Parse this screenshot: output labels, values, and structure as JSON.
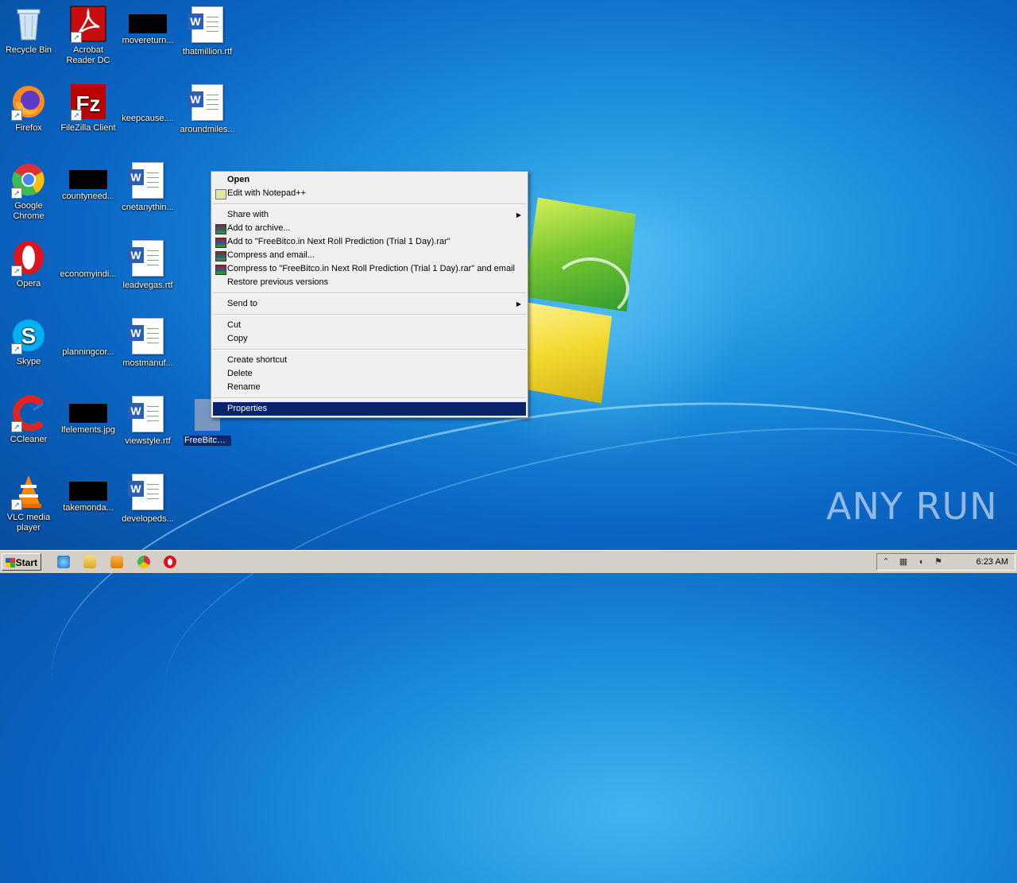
{
  "desktop": {
    "icons": [
      {
        "name": "Recycle Bin"
      },
      {
        "name": "Acrobat Reader DC"
      },
      {
        "name": "movereturn..."
      },
      {
        "name": "thatmillion.rtf"
      },
      {
        "name": "Firefox"
      },
      {
        "name": "FileZilla Client"
      },
      {
        "name": "keepcause...."
      },
      {
        "name": "aroundmiles..."
      },
      {
        "name": "Google Chrome"
      },
      {
        "name": "countyneed..."
      },
      {
        "name": "cnetanythin..."
      },
      {
        "name": "Opera"
      },
      {
        "name": "economyindi..."
      },
      {
        "name": "leadvegas.rtf"
      },
      {
        "name": "Skype"
      },
      {
        "name": "planningcor..."
      },
      {
        "name": "mostmanuf..."
      },
      {
        "name": "CCleaner"
      },
      {
        "name": "lfelements.jpg"
      },
      {
        "name": "viewstyle.rtf"
      },
      {
        "name": "VLC media player"
      },
      {
        "name": "takemonda..."
      },
      {
        "name": "developeds..."
      }
    ],
    "selected_file": {
      "name": "FreeBitco.in Next Roll Prediction (Trial 1 Day).bin"
    }
  },
  "context_menu": {
    "items": [
      {
        "label": "Open",
        "bold": true
      },
      {
        "label": "Edit with Notepad++",
        "icon": "notepadpp-icon"
      },
      {
        "label": "Share with",
        "submenu": true
      },
      {
        "label": "Add to archive...",
        "icon": "winrar-icon"
      },
      {
        "label": "Add to \"FreeBitco.in Next Roll Prediction (Trial 1 Day).rar\"",
        "icon": "winrar-icon"
      },
      {
        "label": "Compress and email...",
        "icon": "winrar-icon"
      },
      {
        "label": "Compress to \"FreeBitco.in Next Roll Prediction (Trial 1 Day).rar\" and email",
        "icon": "winrar-icon"
      },
      {
        "label": "Restore previous versions"
      },
      {
        "label": "Send to",
        "submenu": true
      },
      {
        "label": "Cut"
      },
      {
        "label": "Copy"
      },
      {
        "label": "Create shortcut"
      },
      {
        "label": "Delete"
      },
      {
        "label": "Rename"
      },
      {
        "label": "Properties",
        "highlighted": true
      }
    ]
  },
  "taskbar": {
    "start_label": "Start",
    "pinned": [
      "internet-explorer-icon",
      "file-explorer-icon",
      "media-player-icon",
      "chrome-icon",
      "opera-icon"
    ],
    "clock": "6:23 AM"
  },
  "watermark": "ANY RUN",
  "colors": {
    "menu_highlight": "#0a246a",
    "desktop": "#1c8fdc",
    "taskbar": "#d4d0c8"
  }
}
